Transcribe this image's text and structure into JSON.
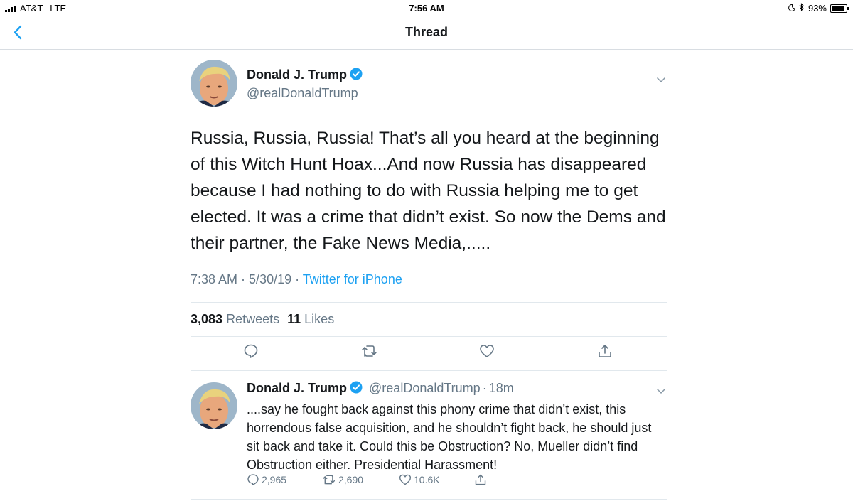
{
  "status_bar": {
    "carrier": "AT&T",
    "network": "LTE",
    "time": "7:56 AM",
    "battery": "93%",
    "battery_level": 0.93
  },
  "nav": {
    "title": "Thread",
    "back_icon": "chevron-left-icon"
  },
  "main_tweet": {
    "name": "Donald J. Trump",
    "handle": "@realDonaldTrump",
    "text": "Russia, Russia, Russia! That’s all you heard at the beginning of this Witch Hunt Hoax...And now Russia has disappeared because I had nothing to do with Russia helping me to get elected. It was a crime that didn’t exist. So now the Dems and their partner, the Fake News Media,.....",
    "time": "7:38 AM",
    "sep1": " · ",
    "date": "5/30/19",
    "sep2": " · ",
    "source": "Twitter for iPhone",
    "retweets_count": "3,083",
    "retweets_label": "Retweets",
    "likes_count": "11",
    "likes_label": "Likes"
  },
  "reply_tweet": {
    "name": "Donald J. Trump",
    "handle": "@realDonaldTrump",
    "dot": "·",
    "age": "18m",
    "text": "....say he fought back against this phony crime that didn’t exist, this horrendous false acquisition, and he shouldn’t fight back, he should just sit back and take it. Could this be Obstruction? No, Mueller didn’t find Obstruction either. Presidential Harassment!",
    "replies": "2,965",
    "retweets": "2,690",
    "likes": "10.6K"
  },
  "colors": {
    "accent": "#1da1f2",
    "text": "#14171a",
    "secondary": "#657786",
    "divider": "#e1e8ed"
  }
}
